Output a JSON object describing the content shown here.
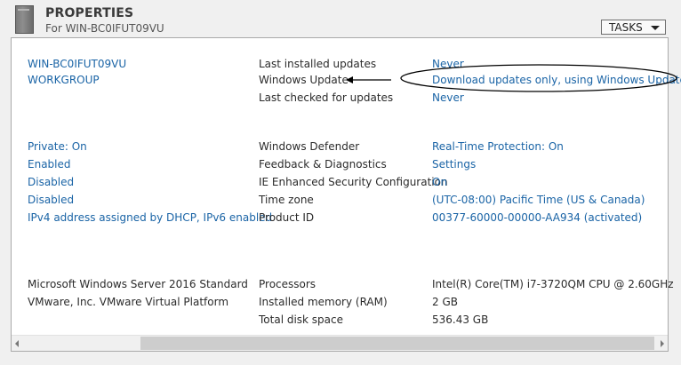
{
  "header": {
    "title": "PROPERTIES",
    "subtitle": "For WIN-BC0IFUT09VU",
    "tasks_label": "TASKS"
  },
  "section1": {
    "left": [
      "WIN-BC0IFUT09VU",
      "WORKGROUP"
    ],
    "labels": [
      "Last installed updates",
      "Windows Update",
      "Last checked for updates"
    ],
    "values": [
      "Never",
      "Download updates only, using Windows Update",
      "Never"
    ]
  },
  "section2": {
    "left": [
      "Private: On",
      "Enabled",
      "Disabled",
      "Disabled",
      "IPv4 address assigned by DHCP, IPv6 enabled"
    ],
    "labels": [
      "Windows Defender",
      "Feedback & Diagnostics",
      "IE Enhanced Security Configuration",
      "Time zone",
      "Product ID"
    ],
    "values": [
      "Real-Time Protection: On",
      "Settings",
      "On",
      "(UTC-08:00) Pacific Time (US & Canada)",
      "00377-60000-00000-AA934 (activated)"
    ]
  },
  "section3": {
    "left": [
      "Microsoft Windows Server 2016 Standard",
      "VMware, Inc. VMware Virtual Platform"
    ],
    "labels": [
      "Processors",
      "Installed memory (RAM)",
      "Total disk space"
    ],
    "values": [
      "Intel(R) Core(TM) i7-3720QM CPU @ 2.60GHz",
      "2 GB",
      "536.43 GB"
    ]
  },
  "colors": {
    "link": "#1a64a6",
    "annotation": "#000000"
  }
}
